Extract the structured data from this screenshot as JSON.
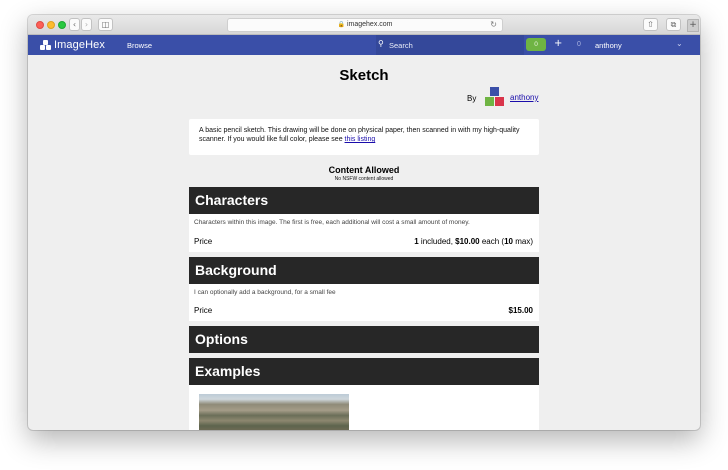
{
  "browser": {
    "url": "imagehex.com"
  },
  "navbar": {
    "logo": "ImageHex",
    "browse": "Browse",
    "search_placeholder": "Search",
    "badge": "0",
    "count": "0",
    "username": "anthony"
  },
  "page": {
    "title": "Sketch",
    "by_label": "By",
    "author": "anthony",
    "description": "A basic pencil sketch. This drawing will be done on physical paper, then scanned in with my high-quality scanner. If you would like full color, please see ",
    "description_link": "this listing",
    "content_allowed": "Content Allowed",
    "content_note": "No NSFW content allowed"
  },
  "sections": {
    "characters": {
      "title": "Characters",
      "description": "Characters within this image. The first is free, each additional will cost a small amount of money.",
      "price_label": "Price",
      "included": "1",
      "included_text": " included, ",
      "each_price": "$10.00",
      "each_text": " each (",
      "max": "10",
      "max_text": " max)"
    },
    "background": {
      "title": "Background",
      "description": "I can optionally add a background, for a small fee",
      "price_label": "Price",
      "price": "$15.00"
    },
    "options": {
      "title": "Options"
    },
    "examples": {
      "title": "Examples"
    }
  },
  "colors": {
    "nav_blue": "#3a4fa8",
    "badge_green": "#6fb443",
    "section_header": "#272727",
    "link": "#1a0dab"
  }
}
